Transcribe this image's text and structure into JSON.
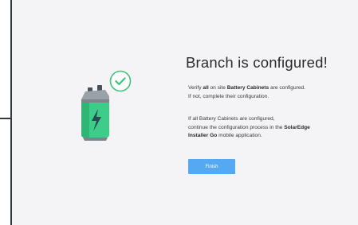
{
  "header": {
    "title": "Branch is configured!"
  },
  "message": {
    "line1_a": "Verify ",
    "line1_b": "all",
    "line1_c": " on site ",
    "line1_d": "Battery Cabinets",
    "line1_e": " are configured.",
    "line2": "If not, complete their configuration.",
    "line3": "If all Battery Cabinets are configured,",
    "line4_a": "continue the configuration process in the ",
    "line4_b": "SolarEdge",
    "line5_a": "Installer Go",
    "line5_b": " mobile application."
  },
  "actions": {
    "finish_label": "Finish"
  },
  "colors": {
    "accent": "#55a8f2",
    "success": "#3cc47c",
    "battery_body": "#3dcc8a",
    "panel_background": "#f4f4f6"
  },
  "icons": {
    "illustration": "battery-charged-icon",
    "status": "check-circle-icon"
  }
}
